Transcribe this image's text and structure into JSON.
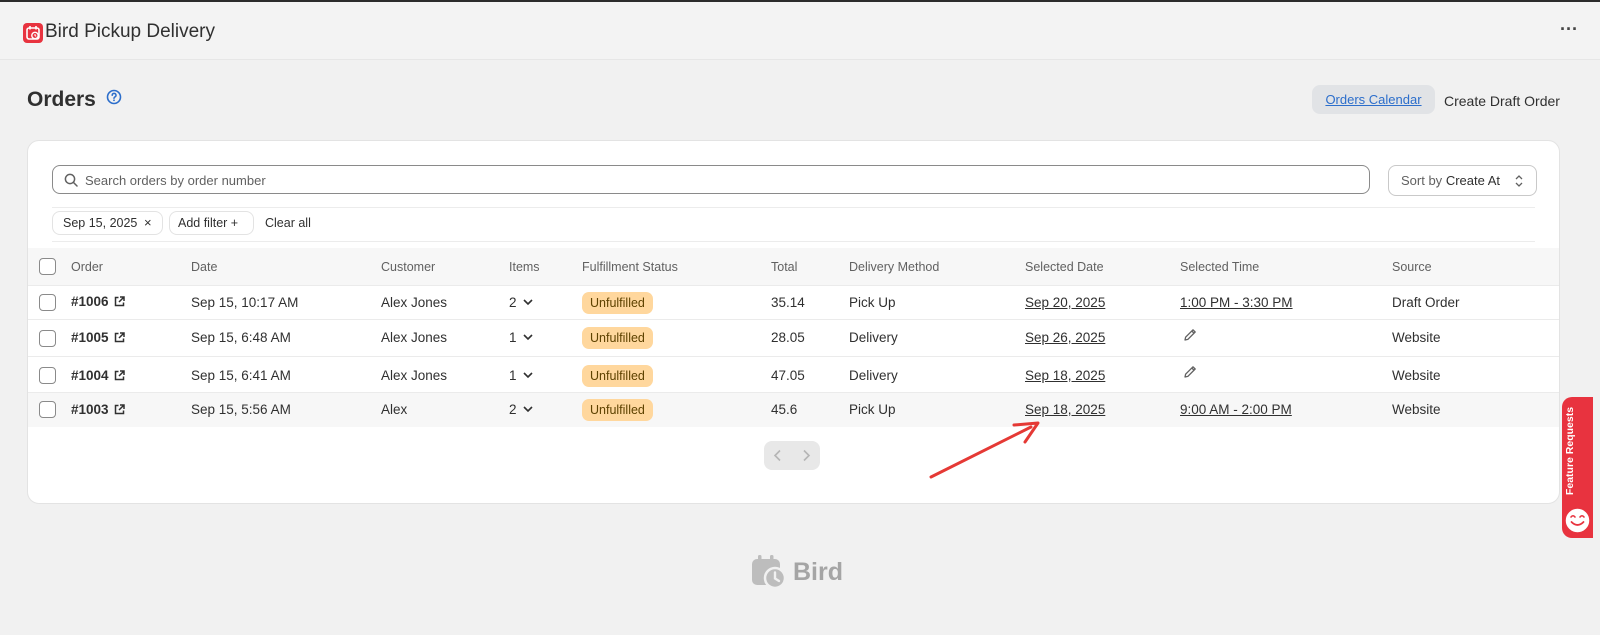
{
  "app": {
    "title": "Bird Pickup Delivery",
    "more_label": "···"
  },
  "page": {
    "title": "Orders",
    "actions": {
      "calendar_label": "Orders Calendar",
      "draft_label": "Create Draft Order"
    }
  },
  "search": {
    "placeholder": "Search orders by order number"
  },
  "sort": {
    "prefix": "Sort by",
    "value": "Create At"
  },
  "filters": {
    "chips": [
      {
        "label": "Sep 15, 2025",
        "remove": "×"
      }
    ],
    "add_filter_label": "Add filter +",
    "clear_all_label": "Clear all"
  },
  "table": {
    "headers": [
      "Order",
      "Date",
      "Customer",
      "Items",
      "Fulfillment Status",
      "Total",
      "Delivery Method",
      "Selected Date",
      "Selected Time",
      "Source"
    ],
    "rows": [
      {
        "order": "#1006",
        "date": "Sep 15, 10:17 AM",
        "customer": "Alex Jones",
        "items": "2",
        "status": "Unfulfilled",
        "total": "35.14",
        "method": "Pick Up",
        "selected_date": "Sep 20, 2025",
        "selected_time": "1:00 PM - 3:30 PM",
        "source": "Draft Order"
      },
      {
        "order": "#1005",
        "date": "Sep 15, 6:48 AM",
        "customer": "Alex Jones",
        "items": "1",
        "status": "Unfulfilled",
        "total": "28.05",
        "method": "Delivery",
        "selected_date": "Sep 26, 2025",
        "selected_time": "",
        "source": "Website"
      },
      {
        "order": "#1004",
        "date": "Sep 15, 6:41 AM",
        "customer": "Alex Jones",
        "items": "1",
        "status": "Unfulfilled",
        "total": "47.05",
        "method": "Delivery",
        "selected_date": "Sep 18, 2025",
        "selected_time": "",
        "source": "Website"
      },
      {
        "order": "#1003",
        "date": "Sep 15, 5:56 AM",
        "customer": "Alex",
        "items": "2",
        "status": "Unfulfilled",
        "total": "45.6",
        "method": "Pick Up",
        "selected_date": "Sep 18, 2025",
        "selected_time": "9:00 AM - 2:00 PM",
        "source": "Website"
      }
    ]
  },
  "footer": {
    "brand": "Bird"
  },
  "feedback_tab": {
    "label": "Feature Requests"
  },
  "colors": {
    "brand_red": "#e8333f",
    "link_blue": "#2c6ecb",
    "badge_bg": "#ffd79d",
    "annotation_arrow": "#e53935"
  }
}
